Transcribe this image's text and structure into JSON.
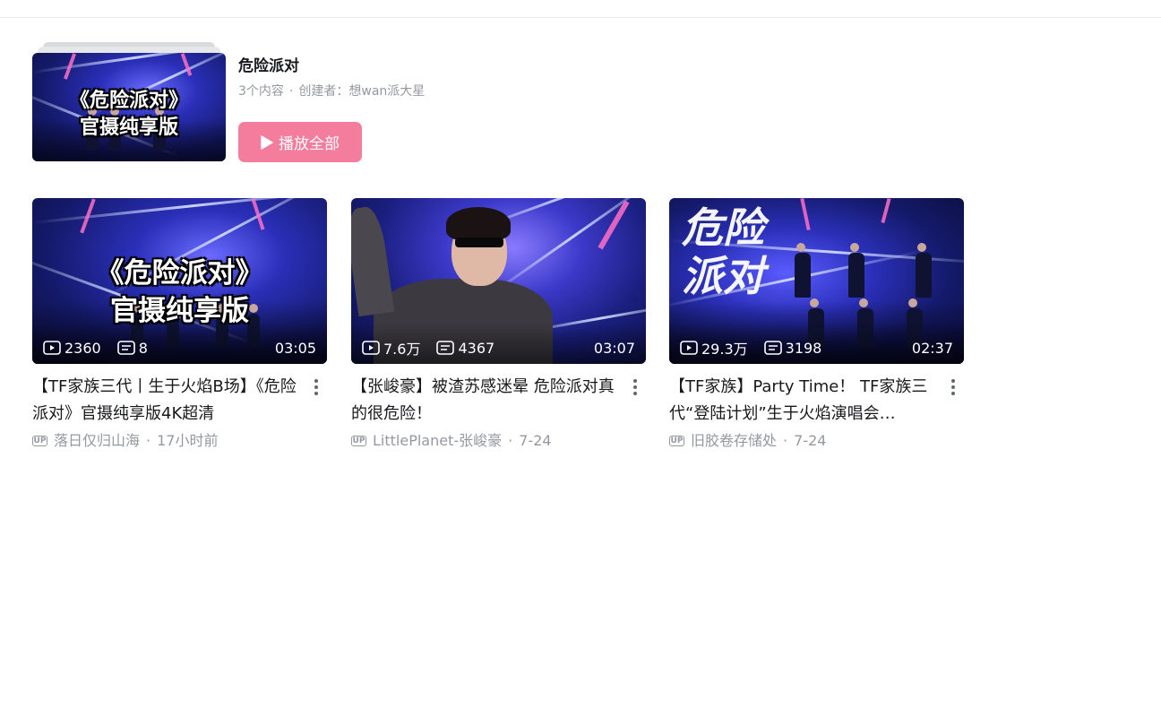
{
  "playlist": {
    "title": "危险派对",
    "count": "3个内容",
    "creator": "创建者：想wan派大星",
    "play_all_label": "播放全部",
    "cover_text_line1": "《危险派对》",
    "cover_text_line2": "官摄纯享版"
  },
  "videos": [
    {
      "title": "【TF家族三代丨生于火焰B场】《危险派对》官摄纯享版4K超清",
      "views": "2360",
      "danmaku": "8",
      "duration": "03:05",
      "uploader": "落日仅归山海",
      "time": "17小时前",
      "cover_text_line1": "《危险派对》",
      "cover_text_line2": "官摄纯享版"
    },
    {
      "title": "【张峻豪】被渣苏感迷晕 危险派对真的很危险！",
      "views": "7.6万",
      "danmaku": "4367",
      "duration": "03:07",
      "uploader": "LittlePlanet-张峻豪",
      "time": "7-24"
    },
    {
      "title": "【TF家族】Party Time！ TF家族三代“登陆计划”生于火焰演唱会…",
      "views": "29.3万",
      "danmaku": "3198",
      "duration": "02:37",
      "uploader": "旧胶卷存储处",
      "time": "7-24",
      "cover_script": "危险派对"
    }
  ],
  "labels": {
    "up_badge": "UP",
    "separator": "·"
  },
  "colors": {
    "accent_pink": "#f47d9d",
    "meta_gray": "#9499a0",
    "text": "#18191c"
  },
  "icons": [
    "play-icon",
    "views-icon",
    "danmaku-icon",
    "more-icon",
    "up-badge"
  ]
}
